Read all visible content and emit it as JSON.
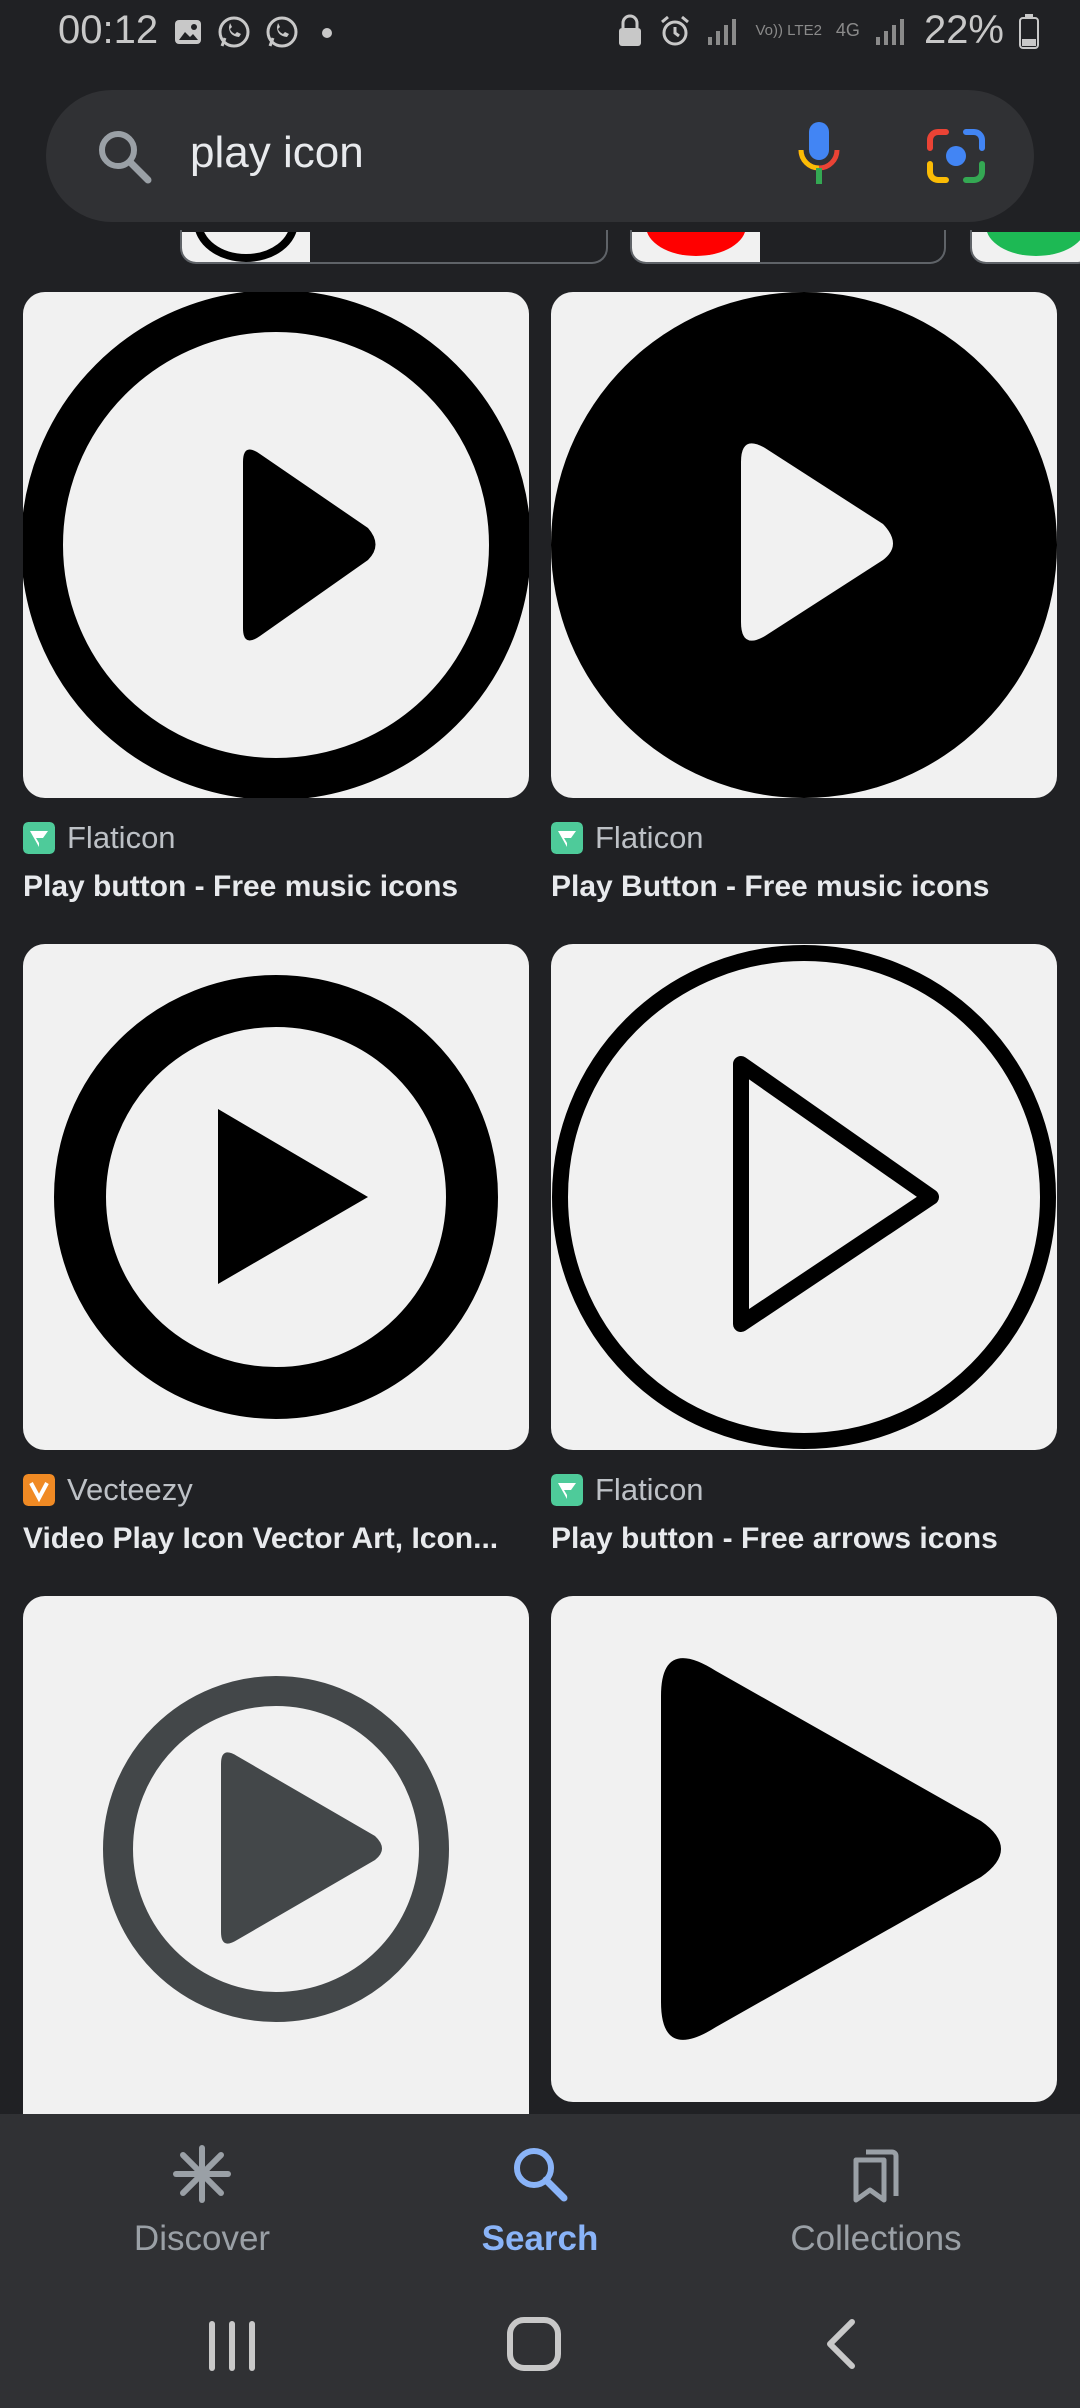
{
  "status_bar": {
    "time": "00:12",
    "battery": "22%",
    "left_icons": [
      "gallery-icon",
      "whatsapp-icon",
      "whatsapp-icon",
      "dot-icon"
    ],
    "right_icons": [
      "lock-icon",
      "alarm-icon",
      "signal-icon",
      "volte-icon",
      "4g-icon",
      "signal-icon",
      "battery-icon"
    ],
    "network_badges": {
      "volte": "Vo)) LTE2",
      "data": "4G"
    }
  },
  "search": {
    "query": "play icon"
  },
  "results": [
    {
      "source": "Flaticon",
      "title": "Play button - Free music icons",
      "logo_color": "#4ecb9a"
    },
    {
      "source": "Flaticon",
      "title": "Play Button - Free music icons",
      "logo_color": "#4ecb9a"
    },
    {
      "source": "Vecteezy",
      "title": "Video Play Icon Vector Art, Icon...",
      "logo_color": "#f08a24"
    },
    {
      "source": "Flaticon",
      "title": "Play button - Free arrows icons",
      "logo_color": "#4ecb9a"
    }
  ],
  "bottom_nav": {
    "items": [
      {
        "label": "Discover",
        "icon": "asterisk-icon"
      },
      {
        "label": "Search",
        "icon": "search-icon",
        "active": true
      },
      {
        "label": "Collections",
        "icon": "collections-icon"
      }
    ]
  },
  "colors": {
    "background": "#202124",
    "accent": "#8ab4f8",
    "surface": "#303134"
  }
}
